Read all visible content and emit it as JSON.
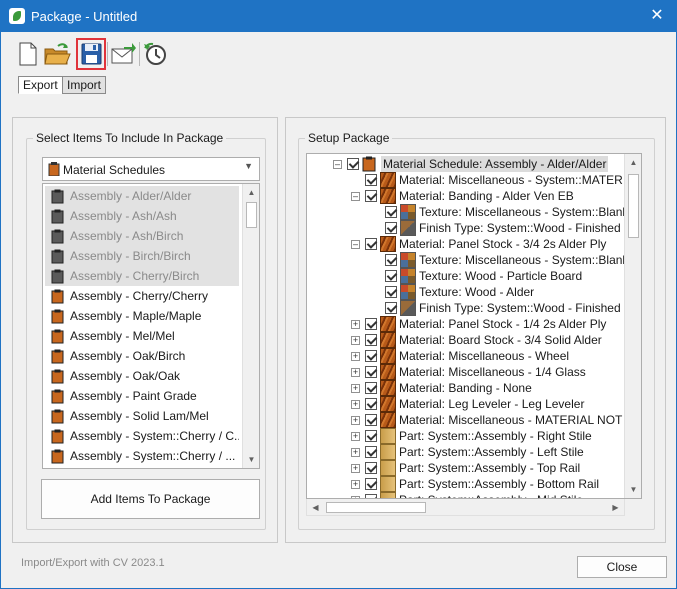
{
  "window": {
    "title": "Package - Untitled"
  },
  "toolbar": {
    "buttons": [
      {
        "name": "new",
        "icon": "new-document-icon"
      },
      {
        "name": "open",
        "icon": "open-folder-icon"
      },
      {
        "name": "save",
        "icon": "save-disk-icon"
      },
      {
        "name": "email",
        "icon": "email-icon"
      },
      {
        "name": "history",
        "icon": "clock-history-icon"
      }
    ]
  },
  "tabs": [
    {
      "label": "Export",
      "active": true
    },
    {
      "label": "Import",
      "active": false
    }
  ],
  "left_panel": {
    "title": "Select Items To Include In Package",
    "dropdown_value": "Material Schedules",
    "items": [
      {
        "label": "Assembly - Alder/Alder",
        "disabled": true
      },
      {
        "label": "Assembly - Ash/Ash",
        "disabled": true
      },
      {
        "label": "Assembly - Ash/Birch",
        "disabled": true
      },
      {
        "label": "Assembly - Birch/Birch",
        "disabled": true
      },
      {
        "label": "Assembly - Cherry/Birch",
        "disabled": true
      },
      {
        "label": "Assembly - Cherry/Cherry",
        "disabled": false
      },
      {
        "label": "Assembly - Maple/Maple",
        "disabled": false
      },
      {
        "label": "Assembly - Mel/Mel",
        "disabled": false
      },
      {
        "label": "Assembly - Oak/Birch",
        "disabled": false
      },
      {
        "label": "Assembly - Oak/Oak",
        "disabled": false
      },
      {
        "label": "Assembly - Paint Grade",
        "disabled": false
      },
      {
        "label": "Assembly - Solid Lam/Mel",
        "disabled": false
      },
      {
        "label": "Assembly - System::Cherry / C...",
        "disabled": false
      },
      {
        "label": "Assembly - System::Cherry / ...",
        "disabled": false
      }
    ],
    "add_button": "Add Items To Package"
  },
  "right_panel": {
    "title": "Setup Package",
    "tree": [
      {
        "label": "Material Schedule: Assembly - Alder/Alder",
        "level": 0,
        "expander": "-",
        "icon": "clipboard",
        "selected": true
      },
      {
        "label": "Material: Miscellaneous - System::MATERIAL NO",
        "level": 1,
        "expander": "",
        "icon": "wood"
      },
      {
        "label": "Material: Banding - Alder Ven EB",
        "level": 1,
        "expander": "-",
        "icon": "wood"
      },
      {
        "label": "Texture: Miscellaneous - System::Blank",
        "level": 2,
        "expander": "",
        "icon": "texture"
      },
      {
        "label": "Finish Type: System::Wood - Finished",
        "level": 2,
        "expander": "",
        "icon": "finish"
      },
      {
        "label": "Material: Panel Stock - 3/4 2s Alder Ply",
        "level": 1,
        "expander": "-",
        "icon": "wood"
      },
      {
        "label": "Texture: Miscellaneous - System::Blank",
        "level": 2,
        "expander": "",
        "icon": "texture"
      },
      {
        "label": "Texture: Wood - Particle Board",
        "level": 2,
        "expander": "",
        "icon": "texture"
      },
      {
        "label": "Texture: Wood - Alder",
        "level": 2,
        "expander": "",
        "icon": "texture"
      },
      {
        "label": "Finish Type: System::Wood - Finished",
        "level": 2,
        "expander": "",
        "icon": "finish"
      },
      {
        "label": "Material: Panel Stock - 1/4 2s Alder Ply",
        "level": 1,
        "expander": "+",
        "icon": "wood"
      },
      {
        "label": "Material: Board Stock - 3/4 Solid Alder",
        "level": 1,
        "expander": "+",
        "icon": "wood"
      },
      {
        "label": "Material: Miscellaneous - Wheel",
        "level": 1,
        "expander": "+",
        "icon": "wood"
      },
      {
        "label": "Material: Miscellaneous - 1/4 Glass",
        "level": 1,
        "expander": "+",
        "icon": "wood"
      },
      {
        "label": "Material: Banding - None",
        "level": 1,
        "expander": "+",
        "icon": "wood"
      },
      {
        "label": "Material: Leg Leveler - Leg Leveler",
        "level": 1,
        "expander": "+",
        "icon": "wood"
      },
      {
        "label": "Material: Miscellaneous - MATERIAL NOT ASSIG",
        "level": 1,
        "expander": "+",
        "icon": "wood"
      },
      {
        "label": "Part: System::Assembly - Right Stile",
        "level": 1,
        "expander": "+",
        "icon": "part"
      },
      {
        "label": "Part: System::Assembly - Left Stile",
        "level": 1,
        "expander": "+",
        "icon": "part"
      },
      {
        "label": "Part: System::Assembly - Top Rail",
        "level": 1,
        "expander": "+",
        "icon": "part"
      },
      {
        "label": "Part: System::Assembly - Bottom Rail",
        "level": 1,
        "expander": "+",
        "icon": "part"
      },
      {
        "label": "Part: System::Assembly - Mid Stile",
        "level": 1,
        "expander": "+",
        "icon": "part"
      }
    ]
  },
  "footer": {
    "version_text": "Import/Export with CV 2023.1",
    "close_button": "Close"
  },
  "colors": {
    "titlebar": "#1f73c4",
    "highlight": "#e0343b"
  }
}
